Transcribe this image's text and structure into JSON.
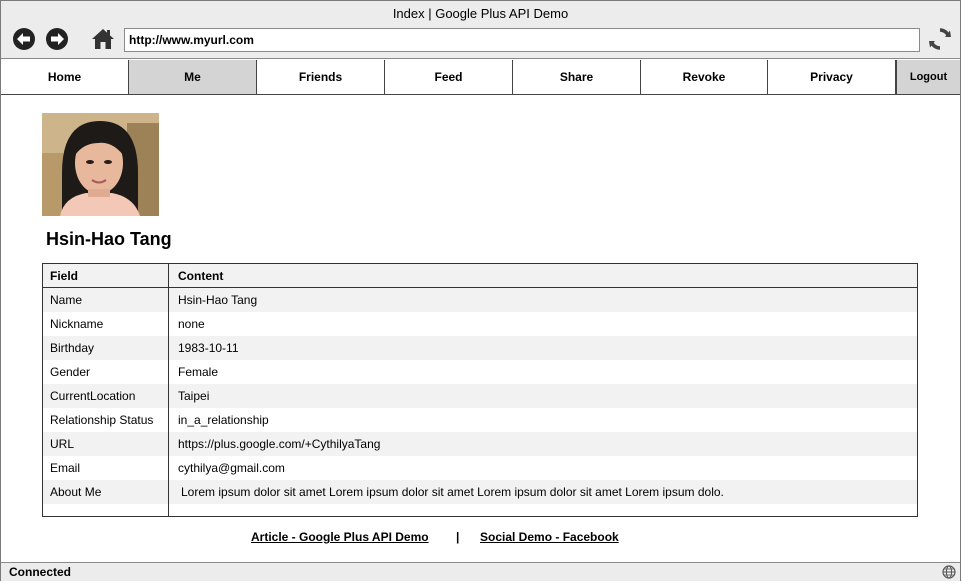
{
  "window": {
    "title": "Index | Google Plus API Demo"
  },
  "browser": {
    "url": "http://www.myurl.com"
  },
  "nav": {
    "tabs": [
      {
        "label": "Home",
        "active": false
      },
      {
        "label": "Me",
        "active": true
      },
      {
        "label": "Friends",
        "active": false
      },
      {
        "label": "Feed",
        "active": false
      },
      {
        "label": "Share",
        "active": false
      },
      {
        "label": "Revoke",
        "active": false
      },
      {
        "label": "Privacy",
        "active": false
      }
    ],
    "logout_label": "Logout"
  },
  "profile": {
    "name": "Hsin-Hao Tang"
  },
  "table": {
    "headers": [
      "Field",
      "Content"
    ],
    "rows": [
      [
        "Name",
        "Hsin-Hao Tang"
      ],
      [
        "Nickname",
        "none"
      ],
      [
        "Birthday",
        "1983-10-11"
      ],
      [
        "Gender",
        "Female"
      ],
      [
        "CurrentLocation",
        "Taipei"
      ],
      [
        "Relationship Status",
        "in_a_relationship"
      ],
      [
        "URL",
        "https://plus.google.com/+CythilyaTang"
      ],
      [
        "Email",
        "cythilya@gmail.com"
      ],
      [
        "About Me",
        "Lorem ipsum dolor sit amet Lorem ipsum dolor sit amet Lorem ipsum dolor sit amet Lorem ipsum dolo."
      ]
    ]
  },
  "footer": {
    "link1": "Article - Google Plus API Demo",
    "separator": "|",
    "link2": "Social Demo - Facebook"
  },
  "status": {
    "text": "Connected"
  },
  "icons": {
    "back": "back-arrow-icon",
    "forward": "forward-arrow-icon",
    "home": "home-icon",
    "reload": "reload-icon",
    "globe": "globe-icon"
  }
}
